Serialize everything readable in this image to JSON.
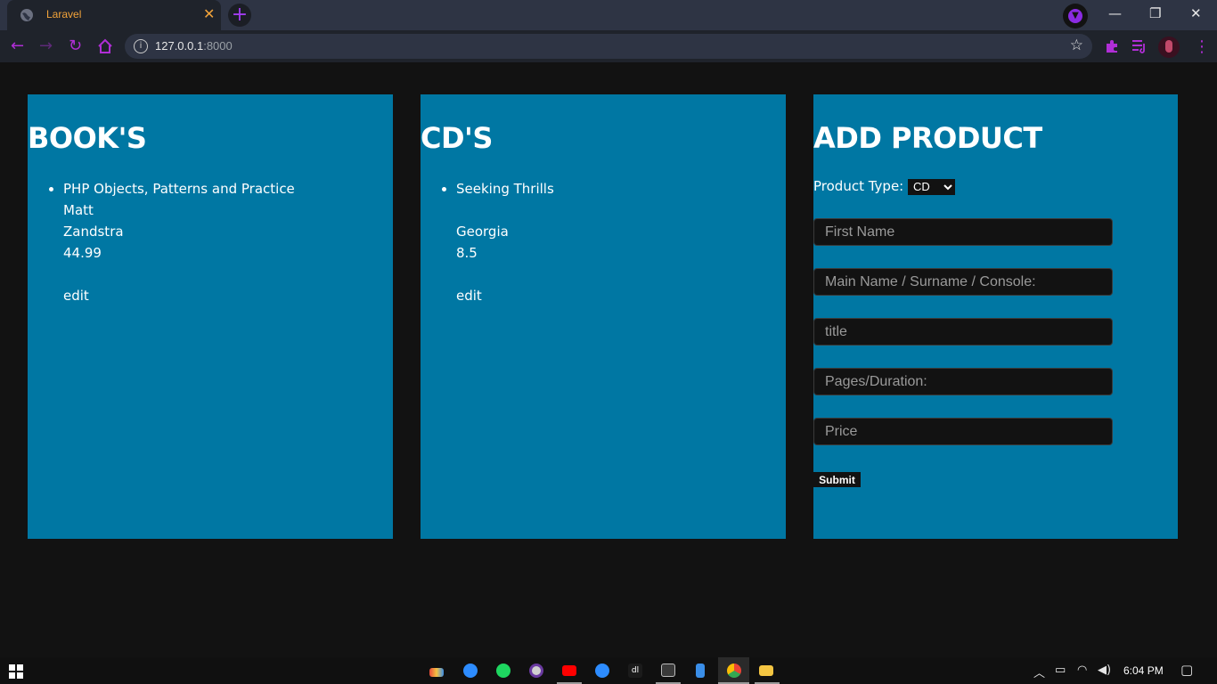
{
  "browser": {
    "tab_title": "Laravel",
    "url_host": "127.0.0.1",
    "url_port": ":8000"
  },
  "books_panel": {
    "heading": "BOOK'S",
    "items": [
      {
        "title": "PHP Objects, Patterns and Practice",
        "first_name": "Matt",
        "main_name": "Zandstra",
        "price": "44.99",
        "edit_label": "edit"
      }
    ]
  },
  "cds_panel": {
    "heading": "CD'S",
    "items": [
      {
        "title": "Seeking Thrills",
        "first_name": "",
        "main_name": "Georgia",
        "price": "8.5",
        "edit_label": "edit"
      }
    ]
  },
  "add_product": {
    "heading": "ADD PRODUCT",
    "type_label": "Product Type:",
    "type_selected": "CD",
    "fields": {
      "first_name": "First Name",
      "main_name": "Main Name / Surname / Console:",
      "title": "title",
      "pages_duration": "Pages/Duration:",
      "price": "Price"
    },
    "submit_label": "Submit"
  },
  "taskbar": {
    "time": "6:04 PM"
  },
  "colors": {
    "panel_bg": "#0077a3",
    "page_bg": "#121212",
    "accent": "#b02ed6"
  }
}
